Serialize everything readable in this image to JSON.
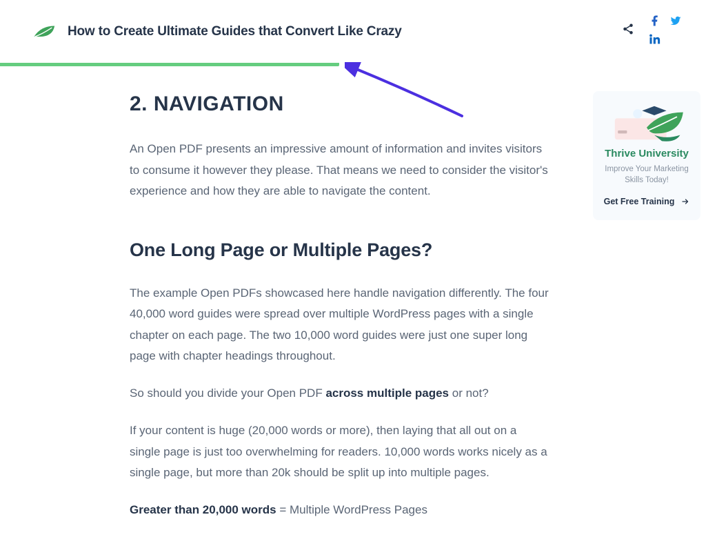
{
  "header": {
    "title": "How to Create Ultimate Guides that Convert Like Crazy"
  },
  "progress": {
    "percent": 48
  },
  "article": {
    "h2": "2. NAVIGATION",
    "p1": "An Open PDF presents an impressive amount of information and invites visitors to consume it however they please. That means we need to consider the visitor's experience and how they are able to navigate the content.",
    "h3": "One Long Page or Multiple Pages?",
    "p2": "The example Open PDFs showcased here handle navigation differently. The four 40,000 word guides were spread over multiple WordPress pages with a single chapter on each page. The two 10,000 word guides were just one super long page with chapter headings throughout.",
    "p3_a": "So should you divide your Open PDF ",
    "p3_strong": "across multiple pages",
    "p3_b": " or not?",
    "p4": "If your content is huge (20,000 words or more), then laying that all out on a single page is just too overwhelming for readers. 10,000 words works nicely as a single page, but more than 20k should be split up into multiple pages.",
    "p5_strong": "Greater than 20,000 words",
    "p5_b": " = Multiple WordPress Pages"
  },
  "sidebar": {
    "title": "Thrive University",
    "subtitle": "Improve Your Marketing Skills Today!",
    "cta": "Get Free Training"
  },
  "colors": {
    "accent_green": "#65cd7f",
    "brand_facebook": "#2563c6",
    "brand_twitter": "#1da1f2",
    "brand_linkedin": "#0a66c2",
    "arrow": "#4b2fe0"
  }
}
